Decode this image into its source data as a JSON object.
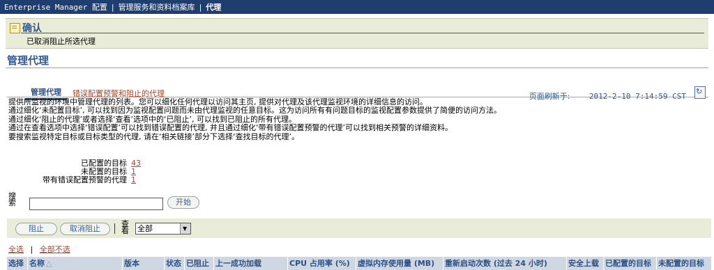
{
  "breadcrumb": {
    "items": [
      "Enterprise Manager 配置",
      "管理服务和资料档案库"
    ],
    "current": "代理"
  },
  "confirmation": {
    "title": "确认",
    "message": "已取消阻止所选代理"
  },
  "page": {
    "title": "管理代理",
    "refresh_label": "页面刷新于:",
    "refresh_time": "2012-2-10 7:14:59 CST"
  },
  "tabs": [
    {
      "label": "管理代理",
      "active": true
    },
    {
      "label": "错误配置预警和阻止的代理",
      "active": false
    }
  ],
  "description": [
    "提供所监视的环境中管理代理的列表。您可以细化任何代理以访问其主页, 提供对代理及该代理监视环境的详细信息的访问。",
    "通过细化‘未配置目标’, 可以找到因为监视配置问题而未由代理监视的任意目标。这为访问所有有问题目标的监视配置参数提供了简便的访问方法。",
    "通过细化‘阻止的代理’或者选择‘查看’选项中的‘已阻止’, 可以找到已阻止的所有代理。",
    "通过在查看选项中选择‘错误配置’可以找到错误配置的代理, 并且通过细化‘带有错误配置预警的代理’可以找到相关预警的详细资料。",
    "要搜索监视特定目标或目标类型的代理, 请在‘相关链接’部分下选择‘查找目标的代理’。"
  ],
  "summary": [
    {
      "label": "已配置的目标",
      "value": "43"
    },
    {
      "label": "未配置的目标",
      "value": "1"
    },
    {
      "label": "带有错误配置预警的代理",
      "value": "1"
    }
  ],
  "search": {
    "label": "搜索",
    "value": "",
    "go_label": "开始"
  },
  "controls": {
    "stop_label": "阻止",
    "unstop_label": "取消阻止",
    "view_label": "查看",
    "view_selected": "全部"
  },
  "selection": {
    "select_all": "全选",
    "select_none": "全部不选"
  },
  "table": {
    "columns": [
      "选择",
      "名称",
      "版本",
      "状态",
      "已阻止",
      "上一成功加载",
      "CPU 占用率 (%)",
      "虚拟内存使用量 (MB)",
      "重新启动次数 (过去 24 小时)",
      "安全上载",
      "已配置的目标",
      "未配置的目标"
    ]
  },
  "icons": {
    "confirm": "note-icon",
    "refresh": "refresh-icon",
    "sort": "sort-ascending-icon"
  },
  "colors": {
    "header_bar": "#1f3d6e",
    "title_blue": "#34598f",
    "link_brown": "#a5462b",
    "panel_beige": "#e9ecd8"
  }
}
